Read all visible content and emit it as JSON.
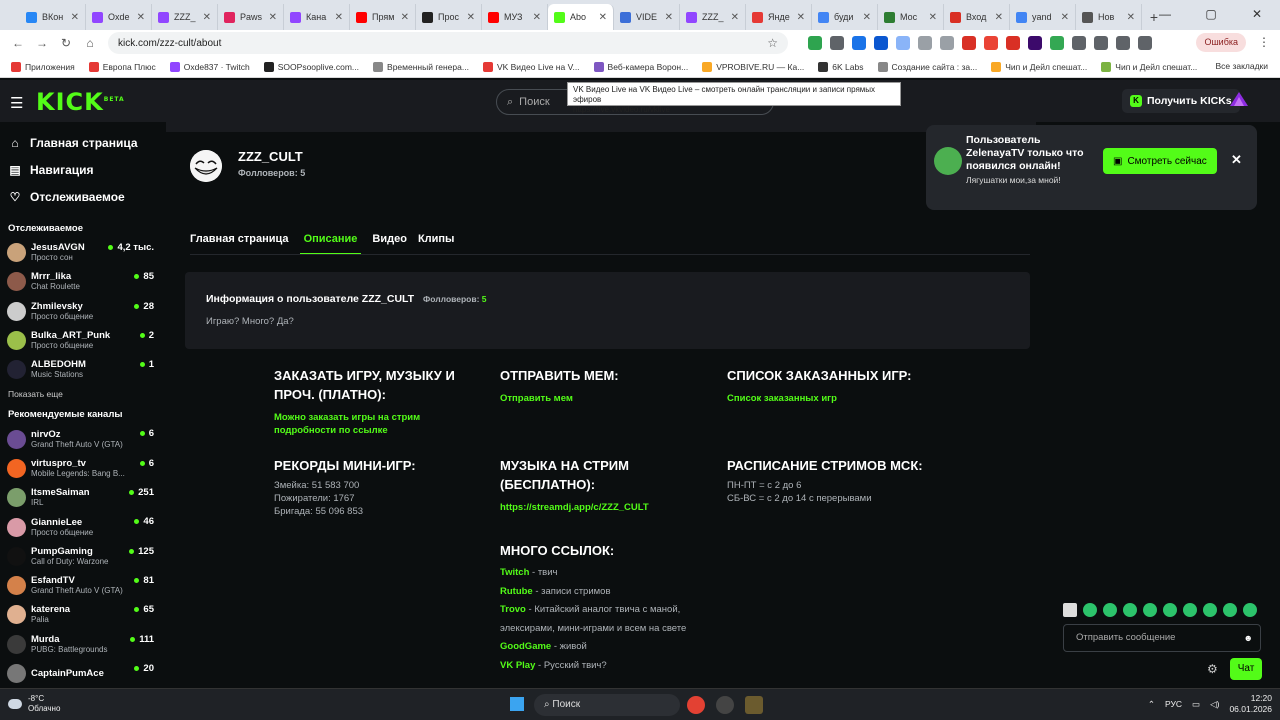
{
  "browser": {
    "tabs": [
      {
        "label": "ВКон",
        "color": "#2787f5",
        "active": false
      },
      {
        "label": "Oxde",
        "color": "#9146ff",
        "active": false
      },
      {
        "label": "ZZZ_",
        "color": "#9146ff",
        "active": false
      },
      {
        "label": "Paws",
        "color": "#e0245e",
        "active": false
      },
      {
        "label": "Кана",
        "color": "#9146ff",
        "active": false
      },
      {
        "label": "Прям",
        "color": "#ff0000",
        "active": false
      },
      {
        "label": "Прос",
        "color": "#222222",
        "active": false
      },
      {
        "label": "МУЗ",
        "color": "#ff0000",
        "active": false
      },
      {
        "label": "Abo",
        "color": "#53fc18",
        "active": true
      },
      {
        "label": "VIDE",
        "color": "#3c6fd8",
        "active": false
      },
      {
        "label": "ZZZ_",
        "color": "#9146ff",
        "active": false
      },
      {
        "label": "Янде",
        "color": "#e53935",
        "active": false
      },
      {
        "label": "буди",
        "color": "#4285f4",
        "active": false
      },
      {
        "label": "Мос",
        "color": "#2e7d32",
        "active": false
      },
      {
        "label": "Вход",
        "color": "#d93025",
        "active": false
      },
      {
        "label": "yand",
        "color": "#4285f4",
        "active": false
      },
      {
        "label": "Нов",
        "color": "#555555",
        "active": false
      }
    ],
    "url": "kick.com/zzz-cult/about",
    "error_button": "Ошибка",
    "bookmarks": [
      {
        "label": "Приложения",
        "color": "#e53935"
      },
      {
        "label": "Европа Плюс",
        "color": "#e53935"
      },
      {
        "label": "Oxde837 · Twitch",
        "color": "#9146ff"
      },
      {
        "label": "SOOPsooplive.com...",
        "color": "#222222"
      },
      {
        "label": "Временный генера...",
        "color": "#888888"
      },
      {
        "label": "VK Видео Live на V...",
        "color": "#e53935"
      },
      {
        "label": "Веб-камера Ворон...",
        "color": "#7e57c2"
      },
      {
        "label": "VPROBIVE.RU — Ка...",
        "color": "#f9a825"
      },
      {
        "label": "6K Labs",
        "color": "#333333"
      },
      {
        "label": "Создание сайта : за...",
        "color": "#888888"
      },
      {
        "label": "Чип и Дейл спешат...",
        "color": "#f9a825"
      },
      {
        "label": "Чип и Дейл спешат...",
        "color": "#7cb342"
      }
    ],
    "all_bookmarks": "Все закладки",
    "tooltip_title": "VK Видео Live на VK Видео Live – смотреть онлайн трансляции и записи прямых эфиров",
    "tooltip_url": "https://live.vkvideo.ru/vklive"
  },
  "header": {
    "logo": "KICK",
    "logo_beta": "BETA",
    "search_placeholder": "Поиск",
    "get_kicks": "Получить KICKs"
  },
  "sidebar": {
    "nav": [
      {
        "label": "Главная страница",
        "icon": "home-icon",
        "glyph": "⌂"
      },
      {
        "label": "Навигация",
        "icon": "browse-icon",
        "glyph": "▤"
      },
      {
        "label": "Отслеживаемое",
        "icon": "heart-icon",
        "glyph": "♡"
      }
    ],
    "following_title": "Отслеживаемое",
    "following": [
      {
        "name": "JesusAVGN",
        "category": "Просто сон",
        "viewers": "4,2 тыс.",
        "color": "#c9a27a"
      },
      {
        "name": "Mrrr_lika",
        "category": "Chat Roulette",
        "viewers": "85",
        "color": "#8d5a4a"
      },
      {
        "name": "Zhmilevsky",
        "category": "Просто общение",
        "viewers": "28",
        "color": "#cccccc"
      },
      {
        "name": "Bulka_ART_Punk",
        "category": "Просто общение",
        "viewers": "2",
        "color": "#9bbf4a"
      },
      {
        "name": "ALBEDOHM",
        "category": "Music Stations",
        "viewers": "1",
        "color": "#222233"
      }
    ],
    "show_more": "Показать еще",
    "recommended_title": "Рекомендуемые каналы",
    "recommended": [
      {
        "name": "nirvOz",
        "category": "Grand Theft Auto V (GTA)",
        "viewers": "6",
        "color": "#6a4c93"
      },
      {
        "name": "virtuspro_tv",
        "category": "Mobile Legends: Bang B...",
        "viewers": "6",
        "color": "#f26522"
      },
      {
        "name": "ItsmeSaiman",
        "category": "IRL",
        "viewers": "251",
        "color": "#7b9e6b"
      },
      {
        "name": "GiannieLee",
        "category": "Просто общение",
        "viewers": "46",
        "color": "#d99aa7"
      },
      {
        "name": "PumpGaming",
        "category": "Call of Duty: Warzone",
        "viewers": "125",
        "color": "#111111"
      },
      {
        "name": "EsfandTV",
        "category": "Grand Theft Auto V (GTA)",
        "viewers": "81",
        "color": "#d4814a"
      },
      {
        "name": "katerena",
        "category": "Palia",
        "viewers": "65",
        "color": "#e0b090"
      },
      {
        "name": "Murda",
        "category": "PUBG: Battlegrounds",
        "viewers": "111",
        "color": "#3a3a3a"
      },
      {
        "name": "CaptainPumAce",
        "category": "",
        "viewers": "20",
        "color": "#777777"
      }
    ]
  },
  "channel": {
    "name": "ZZZ_CULT",
    "followers": "Фолловеров: 5",
    "tabs": [
      "Главная страница",
      "Описание",
      "Видео",
      "Клипы"
    ],
    "active_tab": 1,
    "info_title": "Информация о пользователе ZZZ_CULT",
    "info_followers_label": "Фолловеров:",
    "info_followers_count": "5",
    "info_desc": "Играю? Много? Да?"
  },
  "panels": {
    "order": {
      "title": "ЗАКАЗАТЬ ИГРУ, МУЗЫКУ И ПРОЧ. (ПЛАТНО):",
      "link": "Можно заказать игры на стрим подробности по ссылке"
    },
    "meme": {
      "title": "ОТПРАВИТЬ МЕМ:",
      "link": "Отправить мем"
    },
    "list": {
      "title": "СПИСОК ЗАКАЗАННЫХ ИГР:",
      "link": "Список заказанных игр"
    },
    "records": {
      "title": "РЕКОРДЫ МИНИ-ИГР:",
      "lines": [
        "Змейка: 51 583 700",
        "Пожиратели: 1767",
        "Бригада: 55 096 853"
      ]
    },
    "music": {
      "title": "МУЗЫКА НА СТРИМ (БЕСПЛАТНО):",
      "link": "https://streamdj.app/c/ZZZ_CULT"
    },
    "schedule": {
      "title": "РАСПИСАНИЕ СТРИМОВ МСК:",
      "lines": [
        "ПН-ПТ = с 2 до 6",
        "СБ-ВС = с 2 до 14 с перерывами"
      ]
    },
    "links": {
      "title": "МНОГО ССЫЛОК:",
      "items": [
        {
          "name": "Twitch",
          "desc": " - твич"
        },
        {
          "name": "Rutube",
          "desc": " - записи стримов"
        },
        {
          "name": "Trovo",
          "desc": " - Китайский аналог твича с маной, элексирами, мини-играми и всем на свете"
        },
        {
          "name": "GoodGame",
          "desc": " - живой"
        },
        {
          "name": "VK Play",
          "desc": " - Русский твич?"
        }
      ]
    }
  },
  "notification": {
    "message": "Пользователь ZelenayaTV только что появился онлайн!",
    "sub": "Лягушатки мои,за мной!",
    "watch": "Смотреть сейчас"
  },
  "chat": {
    "placeholder": "Отправить сообщение",
    "send": "Чат"
  },
  "taskbar": {
    "temp": "-8°C",
    "weather": "Облачно",
    "search": "Поиск",
    "lang": "РУС",
    "time": "12:20",
    "date": "06.01.2026"
  }
}
